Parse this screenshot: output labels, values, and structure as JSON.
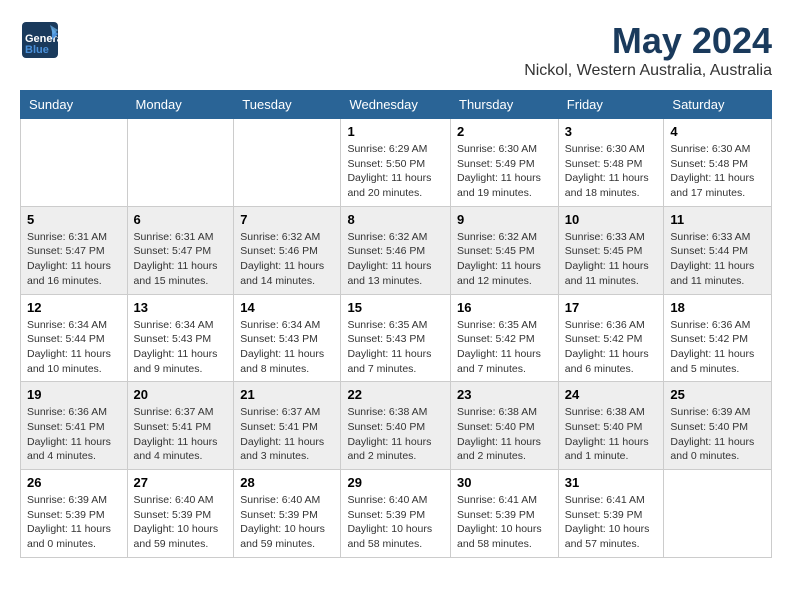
{
  "logo": {
    "general": "General",
    "blue": "Blue"
  },
  "header": {
    "month": "May 2024",
    "location": "Nickol, Western Australia, Australia"
  },
  "weekdays": [
    "Sunday",
    "Monday",
    "Tuesday",
    "Wednesday",
    "Thursday",
    "Friday",
    "Saturday"
  ],
  "weeks": [
    [
      {
        "day": "",
        "info": ""
      },
      {
        "day": "",
        "info": ""
      },
      {
        "day": "",
        "info": ""
      },
      {
        "day": "1",
        "info": "Sunrise: 6:29 AM\nSunset: 5:50 PM\nDaylight: 11 hours\nand 20 minutes."
      },
      {
        "day": "2",
        "info": "Sunrise: 6:30 AM\nSunset: 5:49 PM\nDaylight: 11 hours\nand 19 minutes."
      },
      {
        "day": "3",
        "info": "Sunrise: 6:30 AM\nSunset: 5:48 PM\nDaylight: 11 hours\nand 18 minutes."
      },
      {
        "day": "4",
        "info": "Sunrise: 6:30 AM\nSunset: 5:48 PM\nDaylight: 11 hours\nand 17 minutes."
      }
    ],
    [
      {
        "day": "5",
        "info": "Sunrise: 6:31 AM\nSunset: 5:47 PM\nDaylight: 11 hours\nand 16 minutes."
      },
      {
        "day": "6",
        "info": "Sunrise: 6:31 AM\nSunset: 5:47 PM\nDaylight: 11 hours\nand 15 minutes."
      },
      {
        "day": "7",
        "info": "Sunrise: 6:32 AM\nSunset: 5:46 PM\nDaylight: 11 hours\nand 14 minutes."
      },
      {
        "day": "8",
        "info": "Sunrise: 6:32 AM\nSunset: 5:46 PM\nDaylight: 11 hours\nand 13 minutes."
      },
      {
        "day": "9",
        "info": "Sunrise: 6:32 AM\nSunset: 5:45 PM\nDaylight: 11 hours\nand 12 minutes."
      },
      {
        "day": "10",
        "info": "Sunrise: 6:33 AM\nSunset: 5:45 PM\nDaylight: 11 hours\nand 11 minutes."
      },
      {
        "day": "11",
        "info": "Sunrise: 6:33 AM\nSunset: 5:44 PM\nDaylight: 11 hours\nand 11 minutes."
      }
    ],
    [
      {
        "day": "12",
        "info": "Sunrise: 6:34 AM\nSunset: 5:44 PM\nDaylight: 11 hours\nand 10 minutes."
      },
      {
        "day": "13",
        "info": "Sunrise: 6:34 AM\nSunset: 5:43 PM\nDaylight: 11 hours\nand 9 minutes."
      },
      {
        "day": "14",
        "info": "Sunrise: 6:34 AM\nSunset: 5:43 PM\nDaylight: 11 hours\nand 8 minutes."
      },
      {
        "day": "15",
        "info": "Sunrise: 6:35 AM\nSunset: 5:43 PM\nDaylight: 11 hours\nand 7 minutes."
      },
      {
        "day": "16",
        "info": "Sunrise: 6:35 AM\nSunset: 5:42 PM\nDaylight: 11 hours\nand 7 minutes."
      },
      {
        "day": "17",
        "info": "Sunrise: 6:36 AM\nSunset: 5:42 PM\nDaylight: 11 hours\nand 6 minutes."
      },
      {
        "day": "18",
        "info": "Sunrise: 6:36 AM\nSunset: 5:42 PM\nDaylight: 11 hours\nand 5 minutes."
      }
    ],
    [
      {
        "day": "19",
        "info": "Sunrise: 6:36 AM\nSunset: 5:41 PM\nDaylight: 11 hours\nand 4 minutes."
      },
      {
        "day": "20",
        "info": "Sunrise: 6:37 AM\nSunset: 5:41 PM\nDaylight: 11 hours\nand 4 minutes."
      },
      {
        "day": "21",
        "info": "Sunrise: 6:37 AM\nSunset: 5:41 PM\nDaylight: 11 hours\nand 3 minutes."
      },
      {
        "day": "22",
        "info": "Sunrise: 6:38 AM\nSunset: 5:40 PM\nDaylight: 11 hours\nand 2 minutes."
      },
      {
        "day": "23",
        "info": "Sunrise: 6:38 AM\nSunset: 5:40 PM\nDaylight: 11 hours\nand 2 minutes."
      },
      {
        "day": "24",
        "info": "Sunrise: 6:38 AM\nSunset: 5:40 PM\nDaylight: 11 hours\nand 1 minute."
      },
      {
        "day": "25",
        "info": "Sunrise: 6:39 AM\nSunset: 5:40 PM\nDaylight: 11 hours\nand 0 minutes."
      }
    ],
    [
      {
        "day": "26",
        "info": "Sunrise: 6:39 AM\nSunset: 5:39 PM\nDaylight: 11 hours\nand 0 minutes."
      },
      {
        "day": "27",
        "info": "Sunrise: 6:40 AM\nSunset: 5:39 PM\nDaylight: 10 hours\nand 59 minutes."
      },
      {
        "day": "28",
        "info": "Sunrise: 6:40 AM\nSunset: 5:39 PM\nDaylight: 10 hours\nand 59 minutes."
      },
      {
        "day": "29",
        "info": "Sunrise: 6:40 AM\nSunset: 5:39 PM\nDaylight: 10 hours\nand 58 minutes."
      },
      {
        "day": "30",
        "info": "Sunrise: 6:41 AM\nSunset: 5:39 PM\nDaylight: 10 hours\nand 58 minutes."
      },
      {
        "day": "31",
        "info": "Sunrise: 6:41 AM\nSunset: 5:39 PM\nDaylight: 10 hours\nand 57 minutes."
      },
      {
        "day": "",
        "info": ""
      }
    ]
  ]
}
